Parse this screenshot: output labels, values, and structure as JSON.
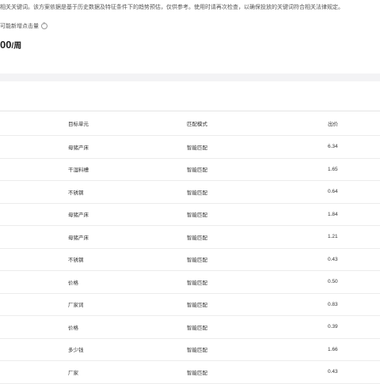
{
  "notice_text": "相关关键词。该方案依据是基于历史数据及特征条件下的趋势预估，仅供参考。使用时请再次检查，以确保投放的关键词符合相关法律规定。",
  "metric": {
    "label": "可能新增点击量",
    "value": "00",
    "unit": "/周"
  },
  "table": {
    "headers": {
      "unit": "目标单元",
      "match": "匹配模式",
      "bid": "出价"
    },
    "rows": [
      {
        "unit": "母猪产床",
        "match": "智能匹配",
        "bid": "6.34"
      },
      {
        "unit": "干湿料槽",
        "match": "智能匹配",
        "bid": "1.65"
      },
      {
        "unit": "不锈钢",
        "match": "智能匹配",
        "bid": "0.64"
      },
      {
        "unit": "母猪产床",
        "match": "智能匹配",
        "bid": "1.84"
      },
      {
        "unit": "母猪产床",
        "match": "智能匹配",
        "bid": "1.21"
      },
      {
        "unit": "不锈钢",
        "match": "智能匹配",
        "bid": "0.43"
      },
      {
        "unit": "价格",
        "match": "智能匹配",
        "bid": "0.50"
      },
      {
        "unit": "厂家词",
        "match": "智能匹配",
        "bid": "0.83"
      },
      {
        "unit": "价格",
        "match": "智能匹配",
        "bid": "0.39"
      },
      {
        "unit": "多少钱",
        "match": "智能匹配",
        "bid": "1.66"
      },
      {
        "unit": "厂家",
        "match": "智能匹配",
        "bid": "0.43"
      }
    ]
  }
}
